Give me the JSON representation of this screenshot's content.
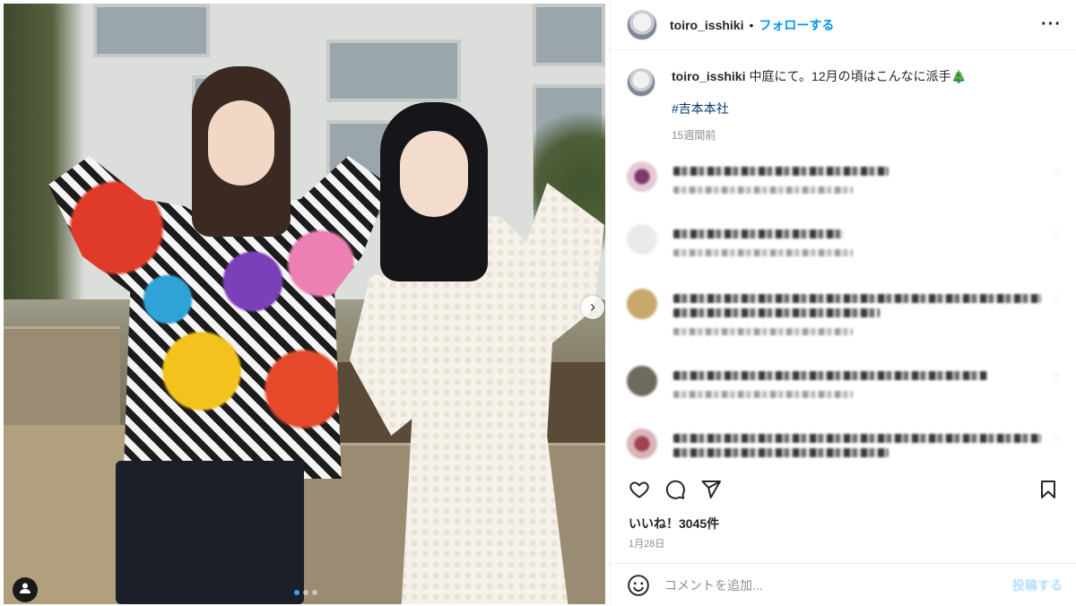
{
  "post": {
    "username": "toiro_isshiki",
    "bullet": "•",
    "follow_label": "フォローする",
    "more_label": "···",
    "carousel_next": "›"
  },
  "caption": {
    "username": "toiro_isshiki",
    "text": "中庭にて。12月の頃はこんなに派手🎄",
    "hashtag": "#吉本本社",
    "time": "15週間前"
  },
  "actions": {
    "likes": "いいね！3045件",
    "date": "1月28日"
  },
  "composer": {
    "placeholder": "コメントを追加...",
    "post_label": "投稿する"
  },
  "colors": {
    "link_blue": "#0095f6",
    "hashtag_blue": "#00376b",
    "muted": "#8e8e8e",
    "active_dot": "#3ea0ee"
  },
  "icons": [
    "user-tag-icon",
    "chevron-right-icon",
    "more-icon",
    "heart-icon",
    "comment-icon",
    "share-icon",
    "bookmark-icon",
    "emoji-icon"
  ]
}
